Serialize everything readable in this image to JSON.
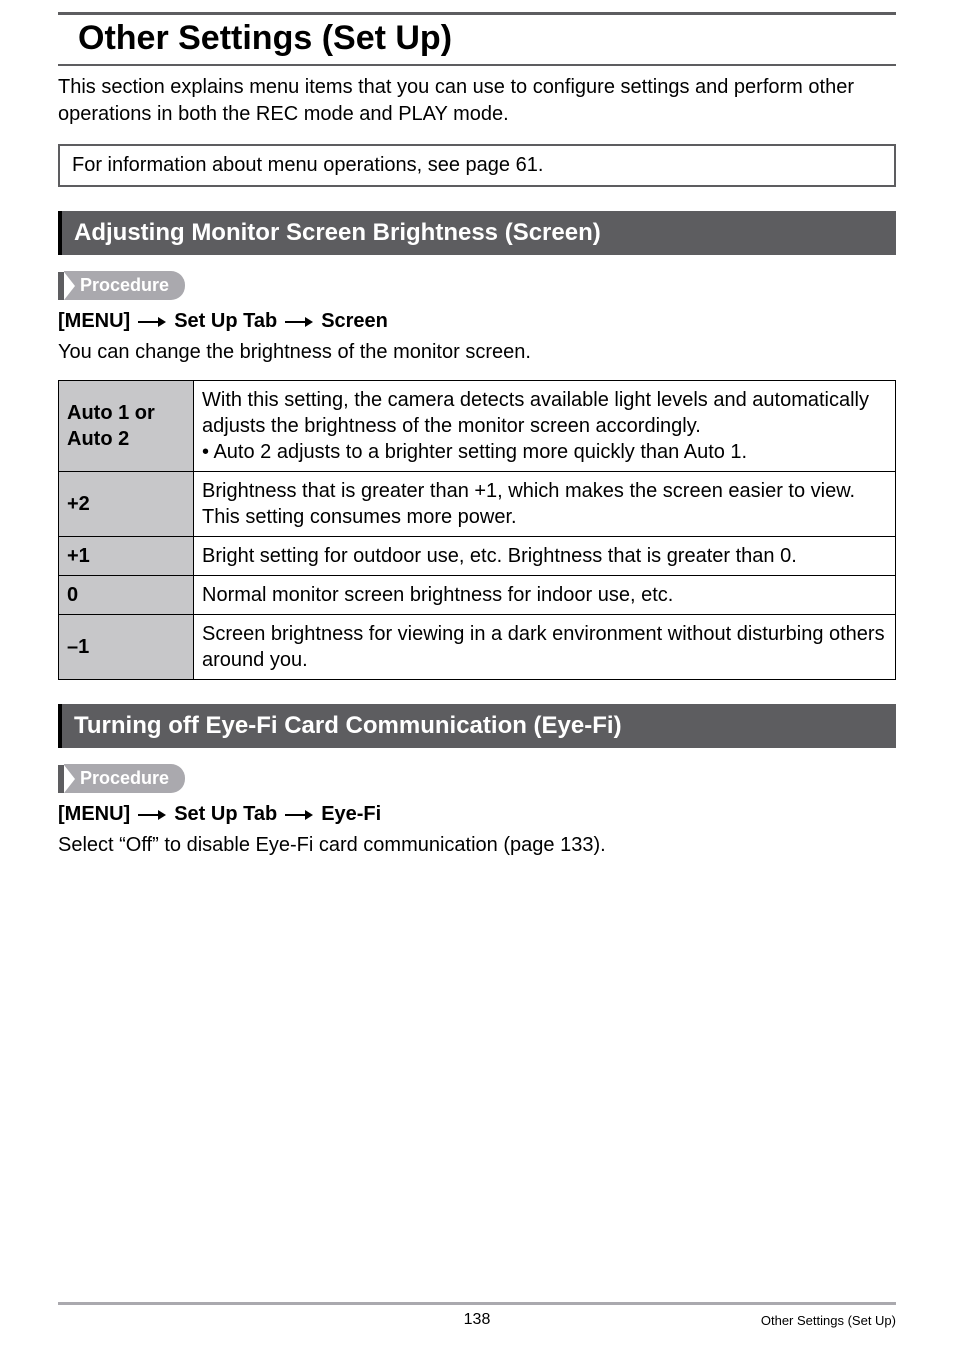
{
  "page": {
    "title": "Other Settings (Set Up)",
    "intro": "This section explains menu items that you can use to configure settings and perform other operations in both the REC mode and PLAY mode.",
    "info_box": "For information about menu operations, see page 61.",
    "page_number": "138",
    "footer_label": "Other Settings (Set Up)"
  },
  "procedure_label": "Procedure",
  "sections": {
    "screen": {
      "heading": "Adjusting Monitor Screen Brightness (Screen)",
      "path": {
        "p1": "[MENU]",
        "p2": "Set Up Tab",
        "p3": "Screen"
      },
      "desc": "You can change the brightness of the monitor screen.",
      "rows": [
        {
          "label": "Auto 1 or Auto 2",
          "text": "With this setting, the camera detects available light levels and automatically adjusts the brightness of the monitor screen accordingly.",
          "bullet": "Auto 2 adjusts to a brighter setting more quickly than Auto 1."
        },
        {
          "label": "+2",
          "text": "Brightness that is greater than +1, which makes the screen easier to view. This setting consumes more power."
        },
        {
          "label": "+1",
          "text": "Bright setting for outdoor use, etc. Brightness that is greater than 0."
        },
        {
          "label": "0",
          "text": "Normal monitor screen brightness for indoor use, etc."
        },
        {
          "label": "–1",
          "text": "Screen brightness for viewing in a dark environment without disturbing others around you."
        }
      ]
    },
    "eyefi": {
      "heading": "Turning off Eye-Fi Card Communication (Eye-Fi)",
      "path": {
        "p1": "[MENU]",
        "p2": "Set Up Tab",
        "p3": "Eye-Fi"
      },
      "desc": "Select “Off” to disable Eye-Fi card communication (page 133)."
    }
  }
}
